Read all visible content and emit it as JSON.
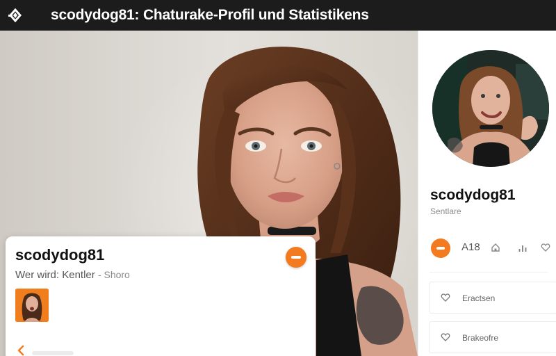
{
  "header": {
    "title": "scodydog81: Chaturake-Profil und Statistikens",
    "app_icon": "logo-icon"
  },
  "profile_card": {
    "username": "scodydog81",
    "subline_label": "Wer wird:",
    "subline_value": "Kentler",
    "subline_extra": "- Shoro",
    "action_icon": "minus-icon",
    "back_icon": "chevron-left-icon"
  },
  "sidebar": {
    "username": "scodydog81",
    "subtitle": "Sentlare",
    "age": "A18",
    "stat_icons": [
      "home-icon",
      "signal-icon",
      "heart-icon"
    ],
    "items": [
      {
        "label": "Eractsen",
        "icon": "heart-icon"
      },
      {
        "label": "Brakeofre",
        "icon": "heart-icon"
      }
    ]
  },
  "colors": {
    "topbar": "#1c1c1c",
    "accent": "#f47a20",
    "background": "#ffffff"
  }
}
